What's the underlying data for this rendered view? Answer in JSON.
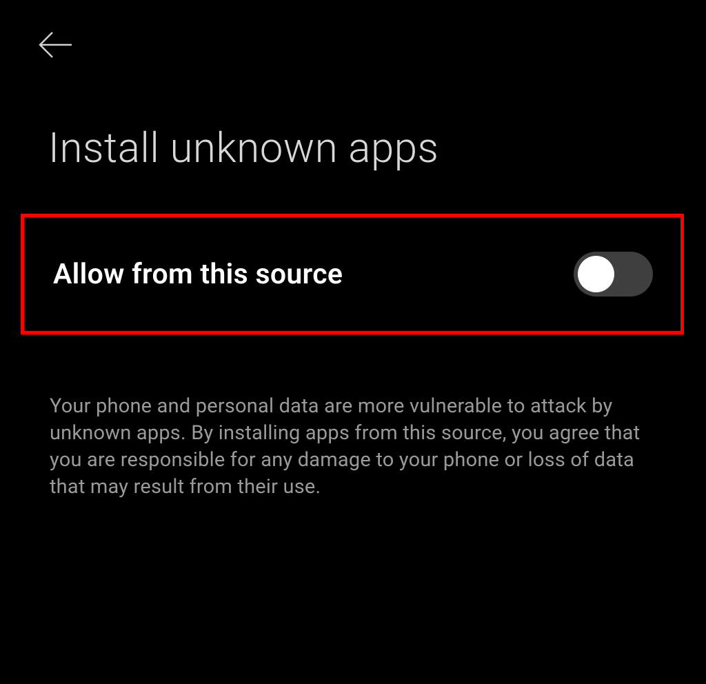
{
  "page": {
    "title": "Install unknown apps"
  },
  "setting": {
    "label": "Allow from this source",
    "enabled": false
  },
  "description": {
    "text": "Your phone and personal data are more vulnerable to attack by unknown apps. By installing apps from this source, you agree that you are responsible for any damage to your phone or loss of data that may result from their use."
  },
  "highlight": {
    "color": "#ff0000"
  }
}
